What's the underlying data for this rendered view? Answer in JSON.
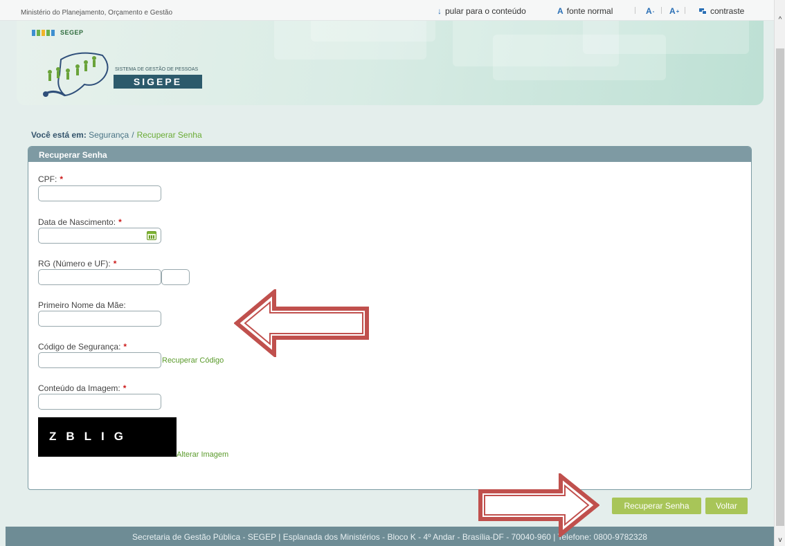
{
  "topbar": {
    "gov_name": "Ministério do Planejamento, Orçamento e Gestão",
    "skip_link": "pular para o conteúdo",
    "font_normal": "fonte normal",
    "font_decrease": "A",
    "font_increase": "A",
    "contrast": "contraste"
  },
  "banner": {
    "segep_logo_text": "SEGEP",
    "system_subtitle": "SISTEMA DE GESTÃO DE PESSOAS",
    "system_name": "SIGEPE"
  },
  "breadcrumb": {
    "label": "Você está em:",
    "items": [
      "Segurança",
      "Recuperar Senha"
    ]
  },
  "form": {
    "title": "Recuperar Senha",
    "fields": {
      "cpf": {
        "label": "CPF:",
        "required": "*",
        "value": ""
      },
      "birth_date": {
        "label": "Data de Nascimento:",
        "required": "*",
        "value": ""
      },
      "rg": {
        "label": "RG (Número e UF):",
        "required": "*",
        "value": "",
        "uf_value": ""
      },
      "mother_name": {
        "label": "Primeiro Nome da Mãe:",
        "value": ""
      },
      "security_code": {
        "label": "Código de Segurança:",
        "required": "*",
        "value": "",
        "link": "Recuperar Código"
      },
      "captcha": {
        "label": "Conteúdo da Imagem:",
        "required": "*",
        "value": "",
        "image_text": "ZBLIG",
        "link": "Alterar Imagem"
      }
    },
    "buttons": {
      "submit": "Recuperar Senha",
      "back": "Voltar"
    }
  },
  "footer": {
    "text": "Secretaria de Gestão Pública - SEGEP | Esplanada dos Ministérios - Bloco K - 4º Andar - Brasília-DF - 70040-960 | Telefone: 0800-9782328"
  },
  "colors": {
    "accent_green": "#a8c558",
    "header_teal": "#7e9aa3",
    "footer_teal": "#6e8c95",
    "link_green": "#5a9a2a",
    "annotation_arrow": "#c0504d"
  }
}
